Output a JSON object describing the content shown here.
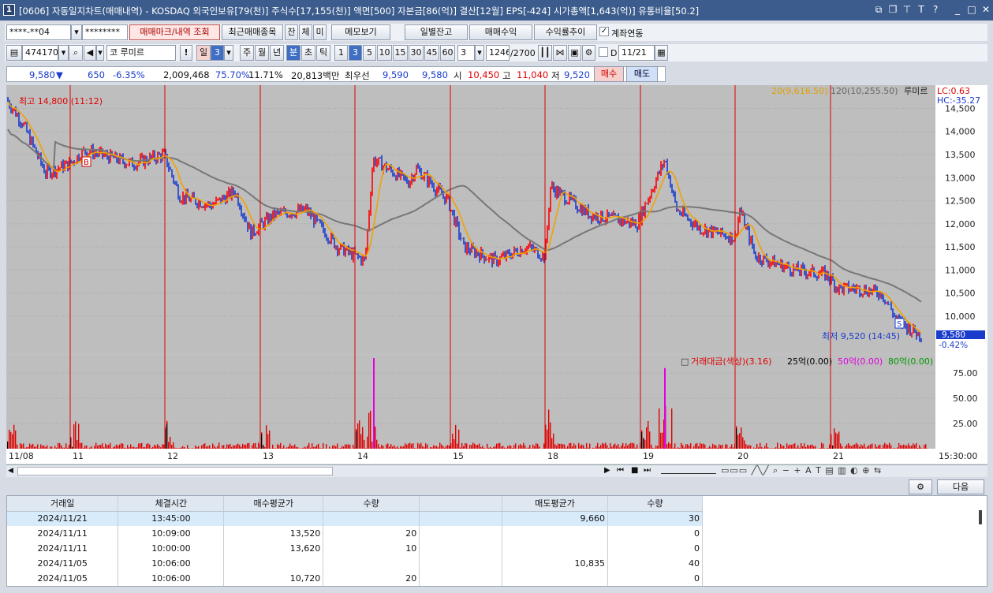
{
  "window": {
    "number": "1",
    "title": "[0606] 자동일지차트(매매내역) - KOSDAQ 외국인보유[79(천)] 주식수[17,155(천)] 액면[500] 자본금[86(억)] 결산[12월] EPS[-424] 시가총액[1,643(억)] 유통비율[50.2]"
  },
  "toolbar1": {
    "account": "****-**04",
    "password": "********",
    "btn_mark": "매매마크/내역 조회",
    "btn_recent": "최근매매종목",
    "btn_jan": "잔",
    "btn_che": "체",
    "btn_mi": "미",
    "btn_memo": "메모보기",
    "btn_daily": "일별잔고",
    "btn_profit": "매매수익",
    "btn_rate": "수익률추이",
    "chk_label": "계좌연동",
    "chk_checked": true
  },
  "toolbar2": {
    "code": "474170",
    "stock_prefix": "코",
    "stock": "루미르",
    "btn_exclaim": "!",
    "periods": [
      "일",
      "3",
      "주",
      "월",
      "년",
      "분",
      "초",
      "틱"
    ],
    "minutes": [
      "1",
      "3",
      "5",
      "10",
      "15",
      "30",
      "45",
      "60"
    ],
    "count": "3",
    "counter": "1246",
    "total": "/2700",
    "d_label": "D",
    "date": "11/21"
  },
  "quote": {
    "price": "9,580",
    "arrow": "▼",
    "change": "650",
    "pct": "-6.35%",
    "volume": "2,009,468",
    "ratio1": "75.70%",
    "ratio2": "11.71%",
    "amount": "20,813백만",
    "best_label": "최우선",
    "best_ask": "9,590",
    "best_bid": "9,580",
    "open_label": "시",
    "open": "10,450",
    "high_label": "고",
    "high": "11,040",
    "low_label": "저",
    "low": "9,520",
    "buy": "매수",
    "sell": "매도"
  },
  "chart": {
    "legend_ma": "20(9,616.50)",
    "legend_ma2": "120(10,255.50)",
    "legend_name": "루미르",
    "lc": "LC:0.63",
    "hc": "HC:-35.27",
    "max_label": "최고 14,800 (11:12)",
    "min_label": "최저 9,520 (14:45)",
    "last": "9,580",
    "last_pct": "-0.42%",
    "vol_legend1": "거래대금(색상)(3.16)",
    "vol_legend2": "25억(0.00)",
    "vol_legend3": "50억(0.00)",
    "vol_legend4": "80억(0.00)",
    "price_ticks": [
      "14,500",
      "14,000",
      "13,500",
      "13,000",
      "12,500",
      "12,000",
      "11,500",
      "11,000",
      "10,500",
      "10,000"
    ],
    "vol_ticks": [
      "75.00",
      "50.00",
      "25.00"
    ],
    "dates": [
      "11/08",
      "11",
      "12",
      "13",
      "14",
      "15",
      "18",
      "19",
      "20",
      "21"
    ],
    "end_time": "15:30:00",
    "marker_b": "B",
    "marker_s": "S",
    "colors": {
      "up": "#ff0000",
      "down": "#1a3ccc",
      "ma20": "#f2a100",
      "ma120": "#777777"
    }
  },
  "chart_data": {
    "type": "line",
    "title": "",
    "xlabel": "",
    "ylabel": "",
    "x": [
      "11/08",
      "11",
      "12",
      "13",
      "14",
      "15",
      "18",
      "19",
      "20",
      "21"
    ],
    "series": [
      {
        "values": [
          14800,
          13400,
          13400,
          12200,
          11000,
          12200,
          11200,
          12200,
          11800,
          9580
        ]
      }
    ],
    "ylim": [
      9300,
      14900
    ],
    "grid": true
  },
  "bottom": {
    "btn_next": "다음"
  },
  "table": {
    "headers": [
      "거래일",
      "체결시간",
      "매수평균가",
      "수량",
      "",
      "매도평균가",
      "수량"
    ],
    "rows": [
      [
        "2024/11/21",
        "13:45:00",
        "",
        "",
        "",
        "9,660",
        "30"
      ],
      [
        "2024/11/11",
        "10:09:00",
        "13,520",
        "20",
        "",
        "",
        "0"
      ],
      [
        "2024/11/11",
        "10:00:00",
        "13,620",
        "10",
        "",
        "",
        "0"
      ],
      [
        "2024/11/05",
        "10:06:00",
        "",
        "",
        "",
        "10,835",
        "40"
      ],
      [
        "2024/11/05",
        "10:06:00",
        "10,720",
        "20",
        "",
        "",
        "0"
      ]
    ]
  }
}
